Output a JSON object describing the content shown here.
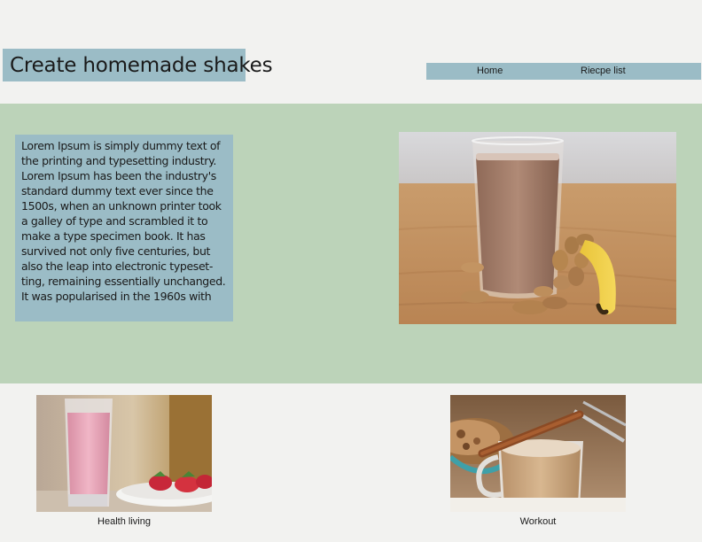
{
  "header": {
    "title": "Create homemade shakes",
    "nav": {
      "home_label": "Home",
      "recipes_label": "Riecpe list"
    }
  },
  "hero": {
    "intro_text": "Lorem Ipsum is simply dummy text of the printing and typesetting industry. Lorem Ipsum has been the industry's standard dummy text ever since the 1500s, when an unknown printer took a galley of type and scrambled it to make a type specimen book. It has survived not only five centuries, but also the leap into electronic typeset-ting, remaining essentially unchanged. It was popularised in the 1960s with",
    "photo_icon": "chocolate-shake-photo"
  },
  "cards": [
    {
      "caption": "Health living",
      "photo_icon": "strawberry-shake-photo"
    },
    {
      "caption": "Workout",
      "photo_icon": "latte-shake-photo"
    }
  ],
  "colors": {
    "page_bg": "#f2f2f0",
    "accent_blue": "#9bbcc6",
    "hero_green": "#bcd3b9"
  }
}
